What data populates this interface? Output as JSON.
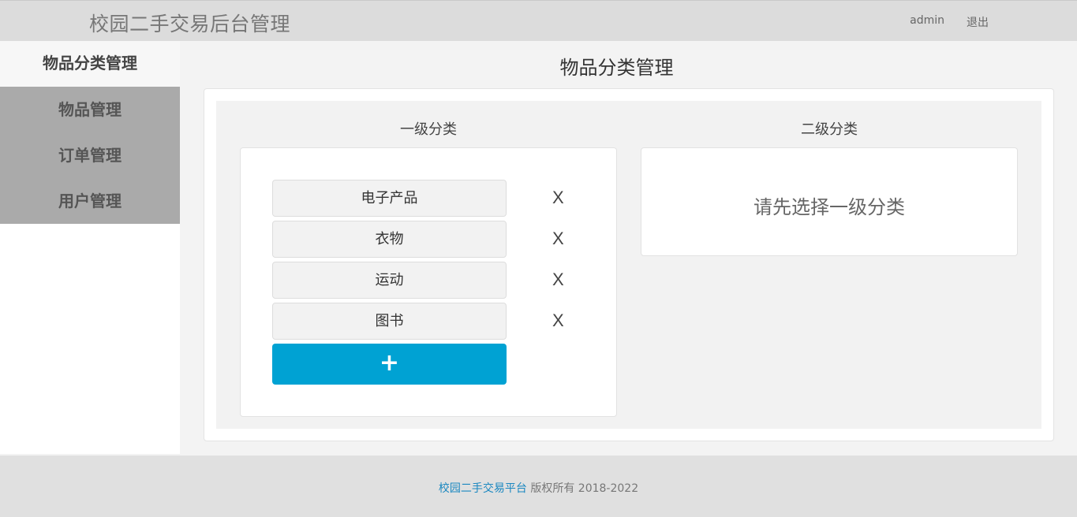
{
  "header": {
    "brand": "校园二手交易后台管理",
    "user": "admin",
    "logout": "退出"
  },
  "sidebar": {
    "items": [
      {
        "label": "物品分类管理"
      },
      {
        "label": "物品管理"
      },
      {
        "label": "订单管理"
      },
      {
        "label": "用户管理"
      }
    ]
  },
  "main": {
    "title": "物品分类管理",
    "level1_title": "一级分类",
    "level2_title": "二级分类",
    "level1_items": [
      {
        "label": "电子产品",
        "delete": "X"
      },
      {
        "label": "衣物",
        "delete": "X"
      },
      {
        "label": "运动",
        "delete": "X"
      },
      {
        "label": "图书",
        "delete": "X"
      }
    ],
    "add_label": "+",
    "level2_hint": "请先选择一级分类"
  },
  "footer": {
    "site": "校园二手交易平台",
    "rights": "版权所有  2018-2022"
  },
  "colors": {
    "accent": "#00a2d3",
    "footer_link": "#1a87c0"
  }
}
